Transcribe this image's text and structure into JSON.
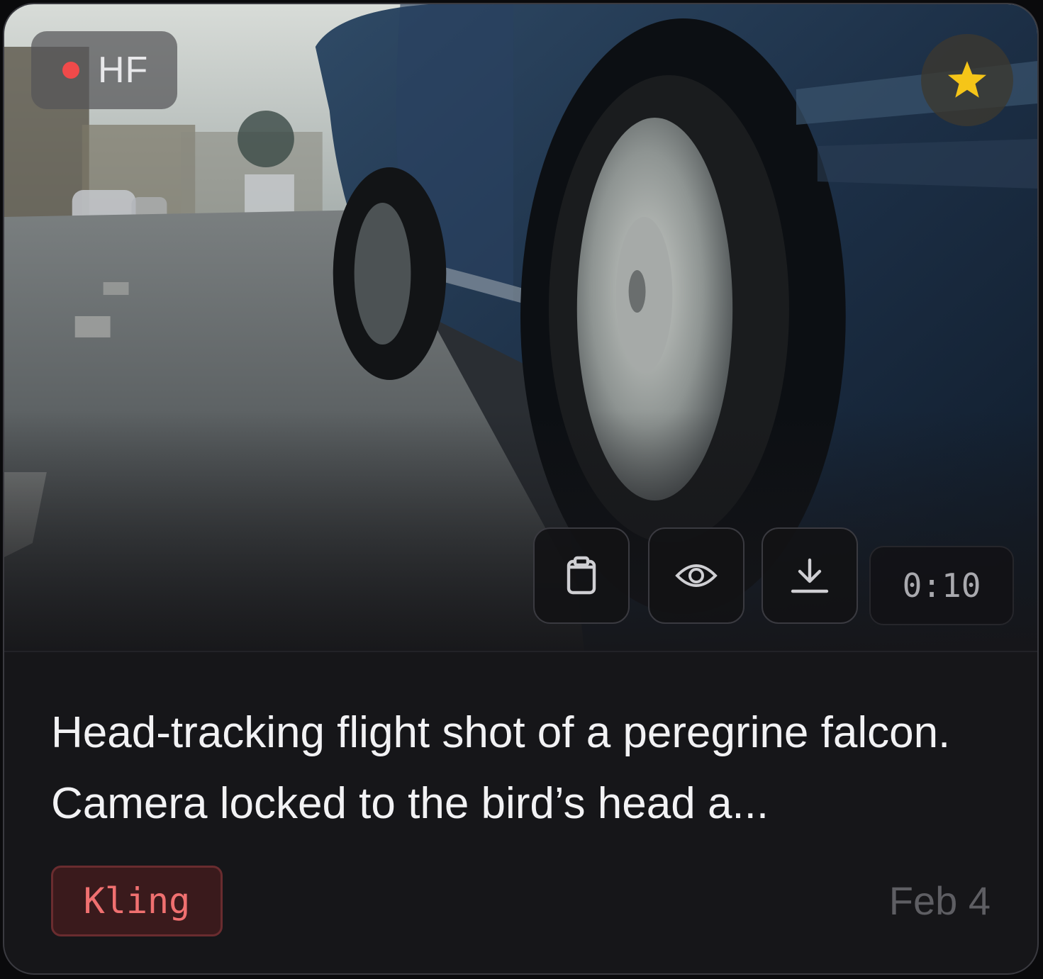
{
  "badge": {
    "label": "HF",
    "dot_color": "#f04a4a"
  },
  "favorite": {
    "icon": "star-icon",
    "state": "starred",
    "color": "#f5c518"
  },
  "actions": [
    {
      "name": "copy-button",
      "icon": "clipboard-icon"
    },
    {
      "name": "preview-button",
      "icon": "eye-icon"
    },
    {
      "name": "download-button",
      "icon": "download-icon"
    }
  ],
  "video": {
    "duration": "0:10"
  },
  "prompt": {
    "text": "Head-tracking flight shot of a peregrine falcon. Camera locked to the bird’s head a..."
  },
  "model_tag": {
    "label": "Kling",
    "color": "#f07070"
  },
  "date": {
    "label": "Feb 4"
  }
}
